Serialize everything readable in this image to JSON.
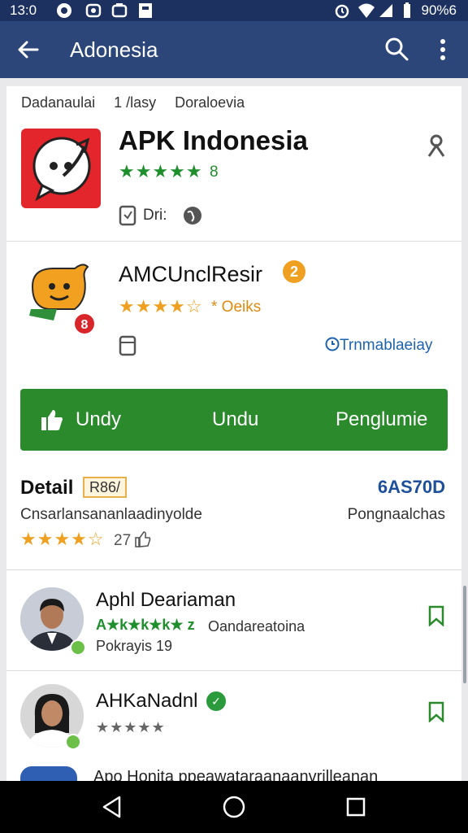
{
  "status_bar": {
    "time": "13:0",
    "battery": "90%6"
  },
  "app_bar": {
    "title": "Adonesia"
  },
  "breadcrumb": [
    "Dadanaulai",
    "1 /lasy",
    "Doraloevia"
  ],
  "app1": {
    "name": "APK Indonesia",
    "stars": "★★★★★",
    "rating": "8",
    "meta": "Dri:"
  },
  "app2": {
    "name": "AMCUnclResir",
    "badge": "2",
    "stars": "★★★★☆",
    "rating": "* Oeiks",
    "link": "Trnmablaeiay"
  },
  "actions": {
    "btn1": "Undy",
    "btn2": "Undu",
    "btn3": "Penglumie"
  },
  "detail": {
    "title": "Detail",
    "tag": "R86/",
    "code": "6AS70D",
    "desc": "Cnsarlansananlaadinyolde",
    "side": "Pongnaalchas",
    "stars": "★★★★☆",
    "count": "27"
  },
  "reviews": [
    {
      "name": "Aphl Deariaman",
      "stars": "A★k★k★k★ z",
      "sub": "Oandareatoina",
      "meta": "Pokrayis 19"
    },
    {
      "name": "AHKaNadnl",
      "stars": "★★★★★"
    }
  ],
  "peek_text": "Apo Honita ppeawataraanaanvrilleanan",
  "colors": {
    "status_bar": "#1d3160",
    "app_bar": "#2c4679",
    "action_green": "#2a8a2c",
    "rating_green": "#1f8f2e",
    "rating_orange": "#f0a020",
    "link_blue": "#1e63b0"
  },
  "icons": [
    "back-arrow-icon",
    "search-icon",
    "more-vert-icon",
    "pin-icon",
    "document-icon",
    "globe-icon",
    "thumb-up-icon",
    "bookmark-icon",
    "nav-back-icon",
    "nav-home-icon",
    "nav-recents-icon"
  ]
}
